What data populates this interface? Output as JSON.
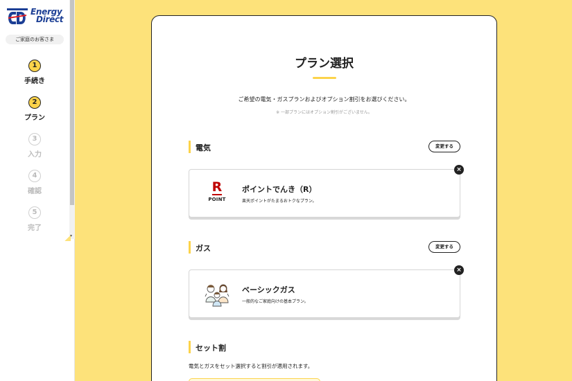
{
  "sidebar": {
    "logo": {
      "line1": "Energy",
      "line2": "Direct"
    },
    "customer_label": "ご家庭のお客さま",
    "steps": [
      {
        "num": "1",
        "label": "手続き",
        "state": "active"
      },
      {
        "num": "2",
        "label": "プラン",
        "state": "active"
      },
      {
        "num": "3",
        "label": "入力",
        "state": "inactive"
      },
      {
        "num": "4",
        "label": "確認",
        "state": "inactive"
      },
      {
        "num": "5",
        "label": "完了",
        "state": "inactive"
      }
    ]
  },
  "main": {
    "title": "プラン選択",
    "lead": "ご希望の電気・ガスプランおよびオプション割引をお選びください。",
    "note": "※ 一部プランにはオプション割引がございません。",
    "sections": {
      "electric": {
        "name": "電気",
        "change_label": "変更する",
        "plan": {
          "logo_letter": "R",
          "logo_sub": "POINT",
          "name": "ポイントでんき（R）",
          "desc": "楽天ポイントがたまるおトクなプラン。"
        }
      },
      "gas": {
        "name": "ガス",
        "change_label": "変更する",
        "plan": {
          "name": "ベーシックガス",
          "desc": "一般的なご家庭向けの基本プラン。"
        }
      },
      "set": {
        "name": "セット割",
        "desc": "電気とガスをセット選択すると割引が適用されます。"
      }
    },
    "close_glyph": "×"
  },
  "colors": {
    "background": "#fde27a",
    "accent": "#fcd34a",
    "brand_blue": "#1c3f95",
    "rakuten_red": "#bf0000"
  }
}
